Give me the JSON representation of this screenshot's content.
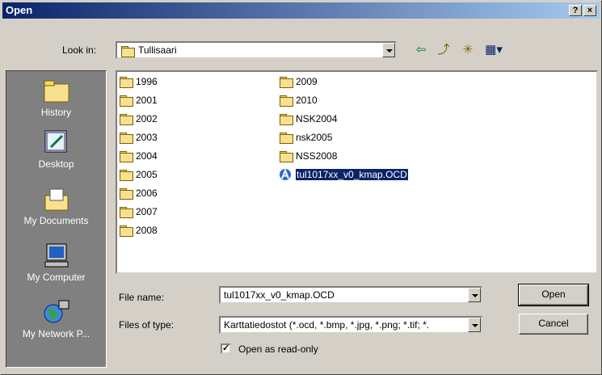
{
  "window": {
    "title": "Open",
    "help_label": "?",
    "close_label": "×"
  },
  "lookin": {
    "label": "Look in:",
    "value": "Tullisaari"
  },
  "toolbar": {
    "back_icon": "⇦",
    "up_icon": "⤴",
    "newfolder_icon": "✳",
    "view_icon": "▦▾"
  },
  "places": [
    {
      "label": "History",
      "icon": "history-icon"
    },
    {
      "label": "Desktop",
      "icon": "desktop-icon"
    },
    {
      "label": "My Documents",
      "icon": "my-documents-icon"
    },
    {
      "label": "My Computer",
      "icon": "my-computer-icon"
    },
    {
      "label": "My Network P...",
      "icon": "network-icon"
    }
  ],
  "files": {
    "col1": [
      "1996",
      "2001",
      "2002",
      "2003",
      "2004",
      "2005",
      "2006",
      "2007",
      "2008"
    ],
    "col2": [
      "2009",
      "2010",
      "NSK2004",
      "nsk2005",
      "NSS2008"
    ],
    "selected": "tul1017xx_v0_kmap.OCD"
  },
  "form": {
    "filename_label": "File name:",
    "filename_value": "tul1017xx_v0_kmap.OCD",
    "filetype_label": "Files of type:",
    "filetype_value": "Karttatiedostot (*.ocd, *.bmp, *.jpg, *.png; *.tif; *.",
    "readonly_label": "Open as read-only",
    "readonly_checked": "✓"
  },
  "buttons": {
    "open": "Open",
    "cancel": "Cancel"
  }
}
